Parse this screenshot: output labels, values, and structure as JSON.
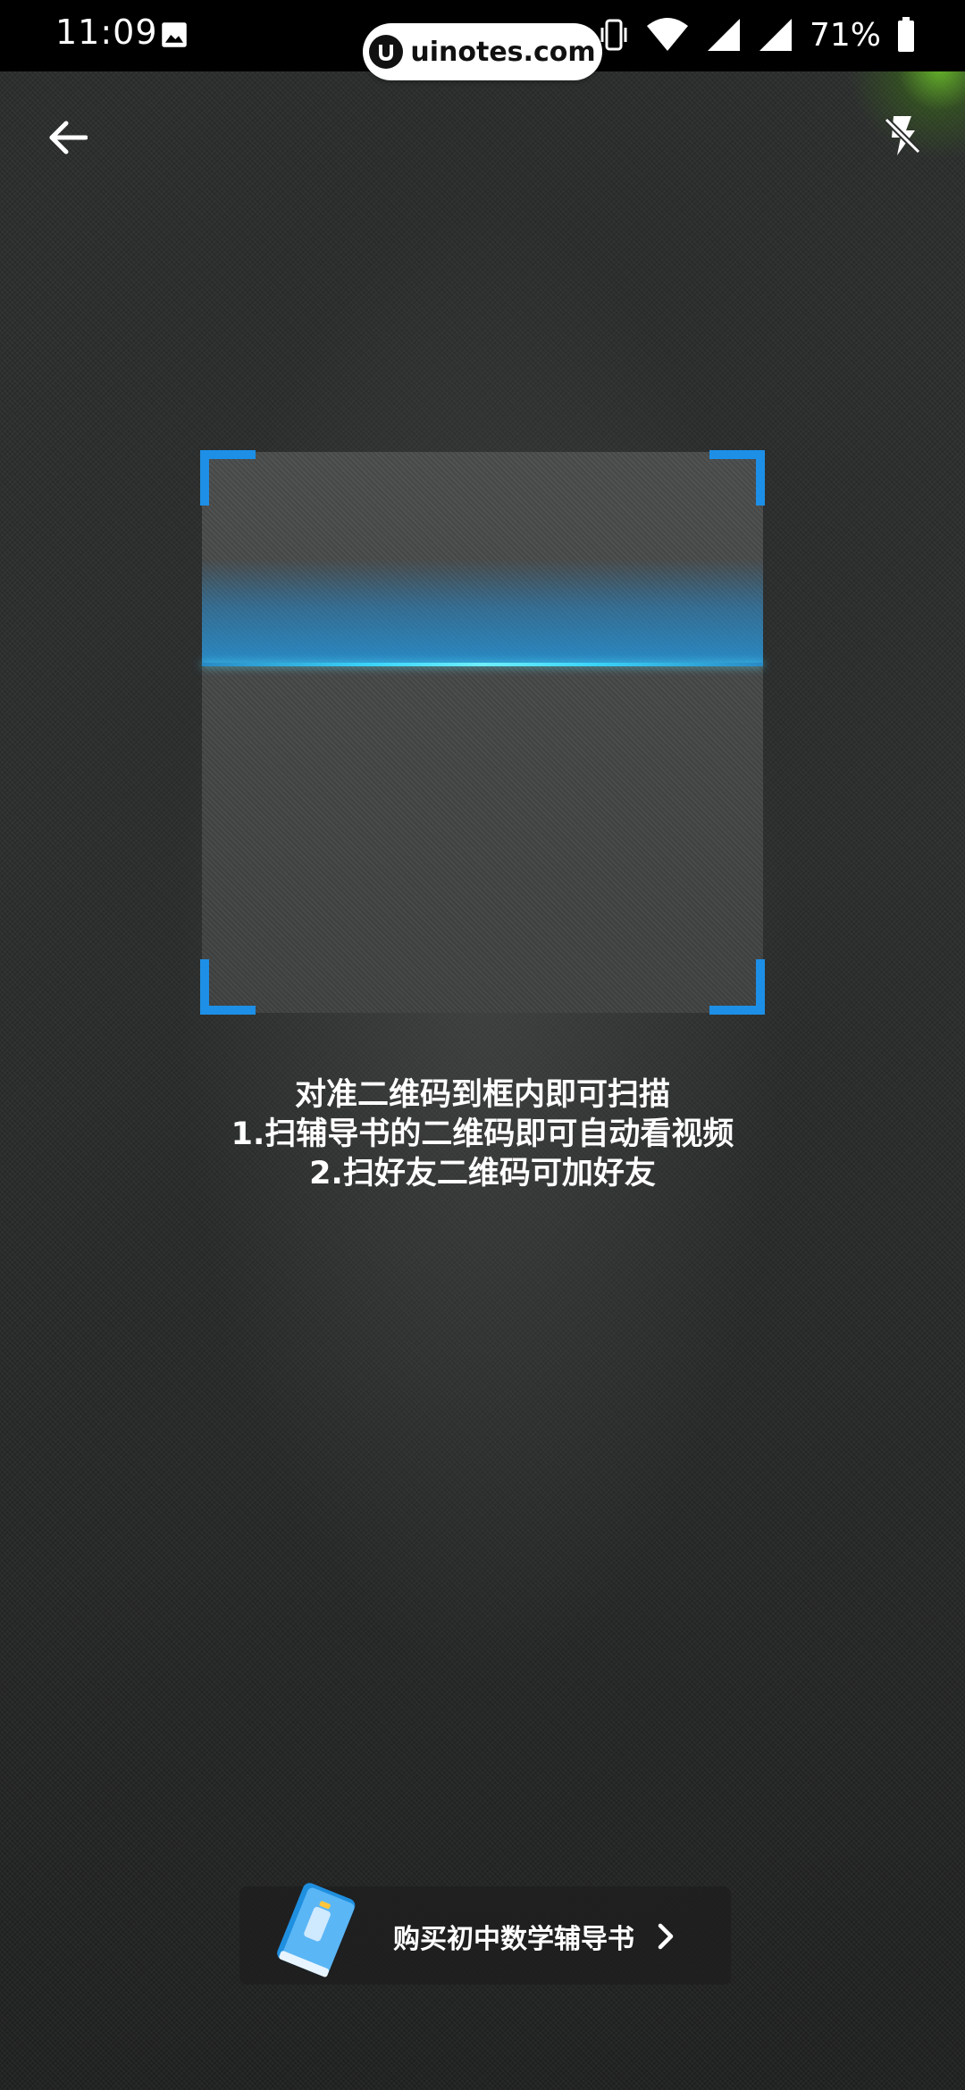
{
  "status_bar": {
    "time": "11:09",
    "battery_percent": "71%",
    "icons": [
      "gallery-icon",
      "vibrate-icon",
      "wifi-icon",
      "signal-icon",
      "signal-icon",
      "battery-icon"
    ]
  },
  "watermark": {
    "text": "uinotes.com"
  },
  "toolbar": {
    "back_icon": "arrow-left-icon",
    "flash_icon": "flash-off-icon"
  },
  "scanner": {
    "accent_color": "#1d8fe6",
    "scan_line_color": "#6ff0ff"
  },
  "instructions": {
    "line1": "对准二维码到框内即可扫描",
    "line2": "1.扫辅导书的二维码即可自动看视频",
    "line3": "2.扫好友二维码可加好友"
  },
  "buy_bar": {
    "label": "购买初中数学辅导书",
    "icon": "book-icon",
    "arrow_icon": "chevron-right-icon"
  }
}
